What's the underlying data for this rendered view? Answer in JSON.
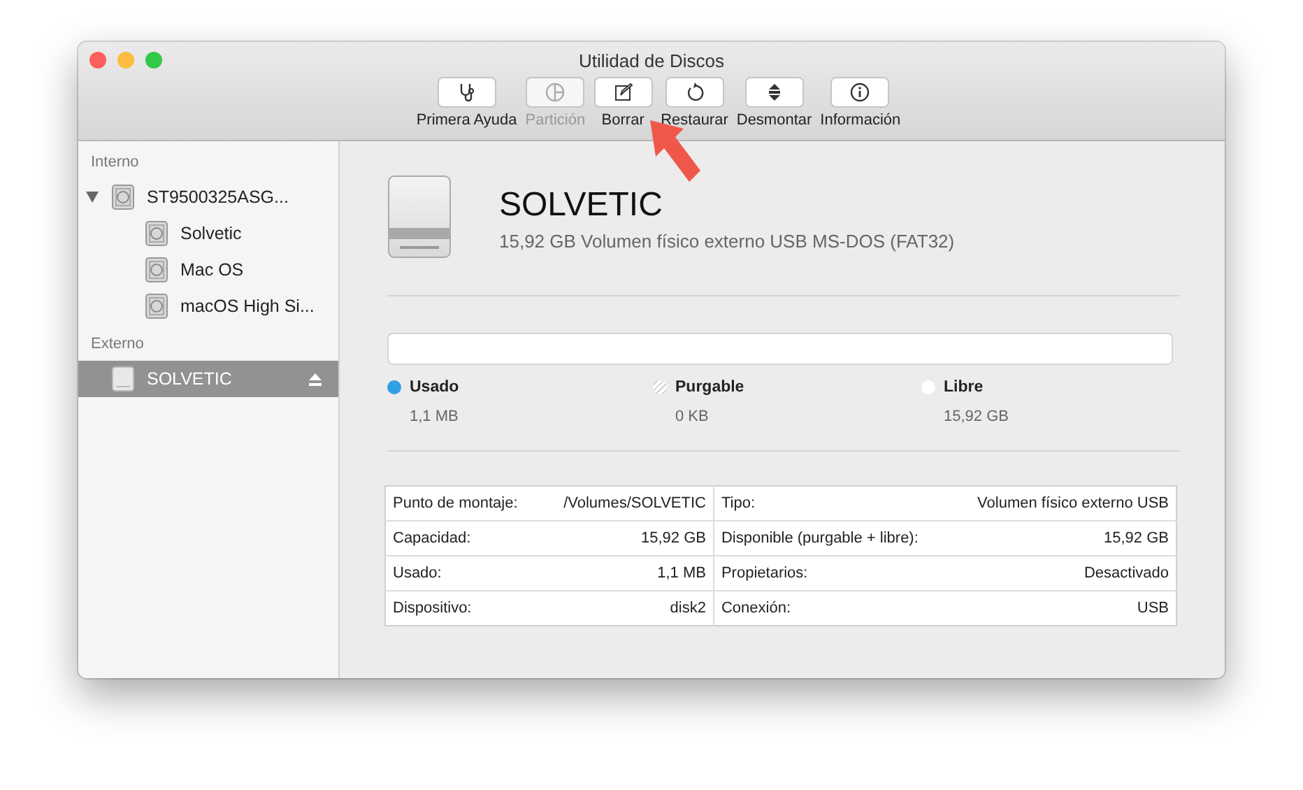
{
  "window": {
    "title": "Utilidad de Discos"
  },
  "toolbar": [
    {
      "label": "Primera Ayuda",
      "kind": "stethoscope",
      "disabled": false
    },
    {
      "label": "Partición",
      "kind": "pie",
      "disabled": true
    },
    {
      "label": "Borrar",
      "kind": "erase",
      "disabled": false
    },
    {
      "label": "Restaurar",
      "kind": "restore",
      "disabled": false
    },
    {
      "label": "Desmontar",
      "kind": "unmount",
      "disabled": false
    },
    {
      "label": "Información",
      "kind": "info",
      "disabled": false
    }
  ],
  "sidebar": {
    "sections": [
      {
        "title": "Interno",
        "items": [
          {
            "label": "ST9500325ASG...",
            "kind": "hdd",
            "expanded": true,
            "selected": false,
            "children": [
              {
                "label": "Solvetic",
                "kind": "hdd",
                "selected": false
              },
              {
                "label": "Mac OS",
                "kind": "hdd",
                "selected": false
              },
              {
                "label": "macOS High Si...",
                "kind": "hdd",
                "selected": false
              }
            ]
          }
        ]
      },
      {
        "title": "Externo",
        "items": [
          {
            "label": "SOLVETIC",
            "kind": "usb",
            "selected": true,
            "ejectable": true
          }
        ]
      }
    ]
  },
  "volume": {
    "name": "SOLVETIC",
    "description": "15,92 GB Volumen físico externo USB MS-DOS (FAT32)"
  },
  "usage": {
    "legend": [
      {
        "label": "Usado",
        "value": "1,1 MB",
        "color": "#2f9fe6",
        "kind": "solid"
      },
      {
        "label": "Purgable",
        "value": "0 KB",
        "color": "#ffffff",
        "kind": "striped"
      },
      {
        "label": "Libre",
        "value": "15,92 GB",
        "color": "#ffffff",
        "kind": "solid"
      }
    ]
  },
  "details": {
    "rows": [
      {
        "label": "Punto de montaje:",
        "value": "/Volumes/SOLVETIC",
        "label_2": "Tipo:",
        "value_2": "Volumen físico externo USB"
      },
      {
        "label": "Capacidad:",
        "value": "15,92 GB",
        "label_2": "Disponible (purgable + libre):",
        "value_2": "15,92 GB"
      },
      {
        "label": "Usado:",
        "value": "1,1 MB",
        "label_2": "Propietarios:",
        "value_2": "Desactivado"
      },
      {
        "label": "Dispositivo:",
        "value": "disk2",
        "label_2": "Conexión:",
        "value_2": "USB"
      }
    ]
  }
}
